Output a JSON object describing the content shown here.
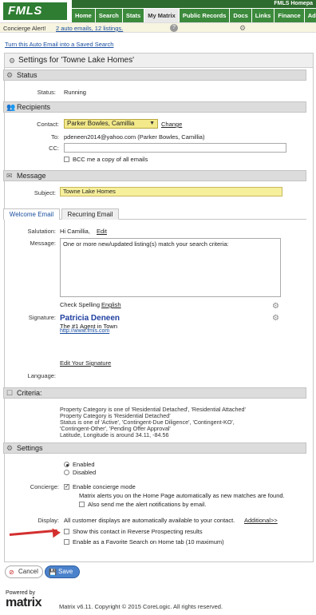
{
  "header": {
    "logo": "FMLS",
    "homepage_label": "FMLS Homepa",
    "tabs": [
      "Home",
      "Search",
      "Stats",
      "My Matrix",
      "Public Records",
      "Docs",
      "Links",
      "Finance",
      "Ad"
    ]
  },
  "alert": {
    "label": "Concierge Alert!",
    "link": "2 auto emails, 12 listings."
  },
  "turn_off_link": "Turn this Auto Email into a Saved Search",
  "panel_title": "Settings for 'Towne Lake Homes'",
  "status": {
    "section": "Status",
    "label": "Status:",
    "value": "Running"
  },
  "recipients": {
    "section": "Recipients",
    "contact_label": "Contact:",
    "contact_value": "Parker Bowles, Camillia",
    "change_link": "Change",
    "to_label": "To:",
    "to_value": "pdeneen2014@yahoo.com (Parker Bowles, Camillia)",
    "cc_label": "CC:",
    "cc_value": "",
    "bcc_label": "BCC me a copy of all emails"
  },
  "message": {
    "section": "Message",
    "subject_label": "Subject:",
    "subject_value": "Towne Lake Homes",
    "tabs": [
      "Welcome Email",
      "Recurring Email"
    ],
    "salutation_label": "Salutation:",
    "salutation_value": "Hi Camillia,",
    "edit_link": "Edit",
    "message_label": "Message:",
    "message_text": "One or more new/updated listing(s) match your search criteria:",
    "spell_label": "Check Spelling",
    "spell_lang": "English",
    "signature_label": "Signature:",
    "sig_name": "Patricia Deneen",
    "sig_tagline": "The #1 Agent in Town",
    "sig_link": "http://www.fmls.com",
    "edit_signature": "Edit Your Signature",
    "language_label": "Language:"
  },
  "criteria": {
    "section": "Criteria:",
    "lines": [
      "Property Category is one of 'Residential Detached', 'Residential Attached'",
      "Property Category is 'Residential Detached'",
      "Status is one of 'Active', 'Contingent-Due Diligence', 'Contingent-KO',",
      "'Contingent-Other', 'Pending Offer Approval'",
      "Latitude, Longitude is around 34.11, -84.56"
    ]
  },
  "settings": {
    "section": "Settings",
    "enabled": "Enabled",
    "disabled": "Disabled",
    "concierge_label": "Concierge:",
    "concierge_mode": "Enable concierge mode",
    "concierge_desc": "Matrix alerts you on the Home Page automatically as new matches are found.",
    "concierge_also": "Also send me the alert notifications by email.",
    "display_label": "Display:",
    "display_text": "All customer displays are automatically available to your contact.",
    "additional_link": "Additional>>",
    "reverse_prospecting": "Show this contact in Reverse Prospecting results",
    "favorite_search": "Enable as a Favorite Search on Home tab (10 maximum)"
  },
  "buttons": {
    "cancel": "Cancel",
    "save": "Save"
  },
  "footer": {
    "powered_by": "Powered by",
    "logo": "matrix",
    "copyright": "Matrix v6.11. Copyright © 2015 CoreLogic. All rights reserved."
  },
  "colors": {
    "nav_green": "#3c8a3c",
    "contact_yellow": "#f3e98a",
    "annotation_red": "#d32f2f",
    "save_blue": "#4b82cc"
  }
}
